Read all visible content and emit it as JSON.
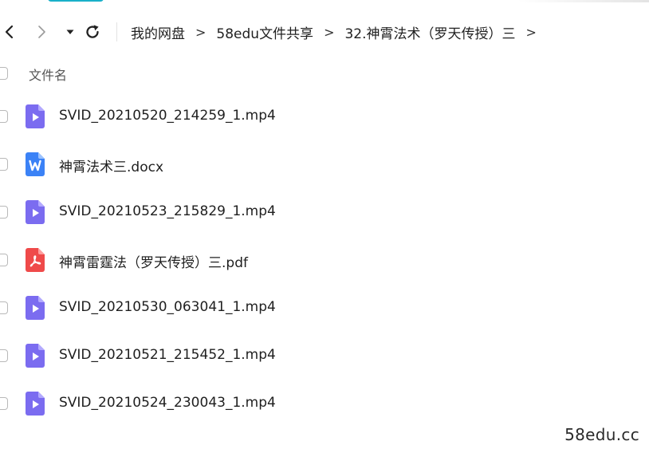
{
  "nav": {
    "back_icon": "chevron-left-icon",
    "forward_icon": "chevron-right-icon",
    "dropdown_icon": "caret-down-icon",
    "refresh_icon": "refresh-icon"
  },
  "breadcrumb": {
    "items": [
      "我的网盘",
      "58edu文件共享",
      "32.神霄法术（罗天传授）三"
    ],
    "separator": ">"
  },
  "header": {
    "column_name": "文件名"
  },
  "files": [
    {
      "name": "SVID_20210520_214259_1.mp4",
      "type": "video",
      "icon": "video-file-icon"
    },
    {
      "name": "神霄法术三.docx",
      "type": "word",
      "icon": "word-file-icon"
    },
    {
      "name": "SVID_20210523_215829_1.mp4",
      "type": "video",
      "icon": "video-file-icon"
    },
    {
      "name": "神霄雷霆法（罗天传授）三.pdf",
      "type": "pdf",
      "icon": "pdf-file-icon"
    },
    {
      "name": "SVID_20210530_063041_1.mp4",
      "type": "video",
      "icon": "video-file-icon"
    },
    {
      "name": "SVID_20210521_215452_1.mp4",
      "type": "video",
      "icon": "video-file-icon"
    },
    {
      "name": "SVID_20210524_230043_1.mp4",
      "type": "video",
      "icon": "video-file-icon"
    }
  ],
  "colors": {
    "video_icon": "#7b6cf0",
    "word_icon": "#3b82f6",
    "pdf_icon": "#ef4a4a",
    "accent": "#19b0c9"
  },
  "watermark": "58edu.cc"
}
